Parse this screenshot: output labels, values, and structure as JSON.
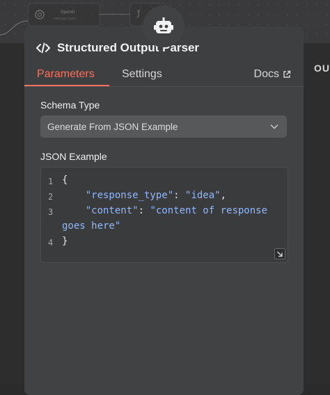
{
  "canvas": {
    "node_openai_title": "OpenAI",
    "node_openai_subtitle": "message model",
    "right_peek_text": "OU"
  },
  "panel": {
    "title": "Structured Output Parser",
    "tabs": [
      {
        "label": "Parameters",
        "active": true
      },
      {
        "label": "Settings",
        "active": false
      }
    ],
    "docs_label": "Docs",
    "accent": "#ff6f5c"
  },
  "fields": {
    "schema_type": {
      "label": "Schema Type",
      "value": "Generate From JSON Example"
    },
    "json_example": {
      "label": "JSON Example",
      "lines": [
        {
          "num": "1",
          "text": "{"
        },
        {
          "num": "2",
          "key": "\"response_type\"",
          "value": "\"idea\"",
          "trail": ","
        },
        {
          "num": "3",
          "key": "\"content\"",
          "value": "\"content of response",
          "wrap": "goes here\""
        },
        {
          "num": "4",
          "text": "}"
        }
      ]
    }
  },
  "icons": {
    "robot": "robot-icon",
    "code": "code-icon",
    "external": "external-link-icon",
    "chevron": "chevron-down-icon",
    "resize": "resize-icon"
  }
}
